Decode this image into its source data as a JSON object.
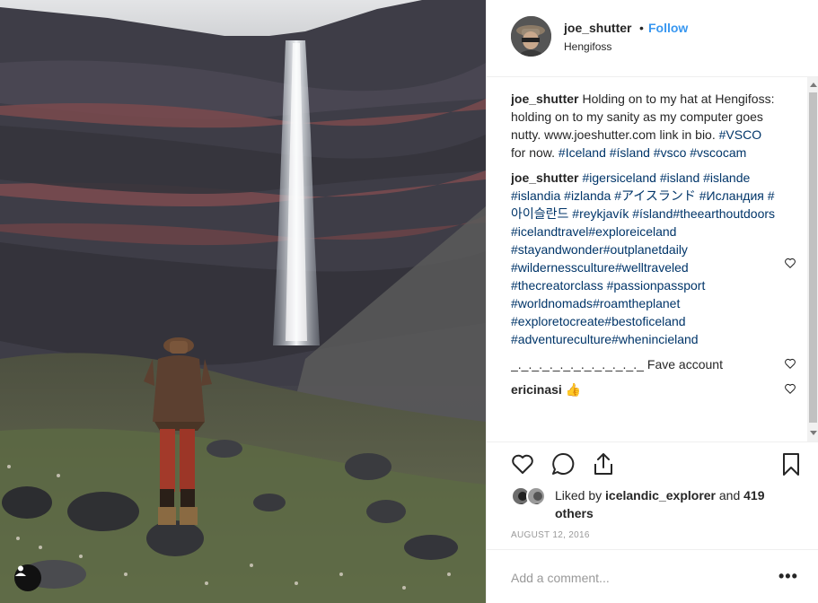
{
  "post": {
    "username": "joe_shutter",
    "separator": "•",
    "follow_label": "Follow",
    "location": "Hengifoss",
    "photo_alt": "Person holding hat in front of Hengifoss waterfall with red-striped canyon walls"
  },
  "comments": [
    {
      "author": "joe_shutter",
      "text": "Holding on to my hat at Hengifoss: holding on to my sanity as my computer goes nutty. www.joeshutter.com link in bio.",
      "tags": [
        "#VSCO",
        " for now. ",
        "#Iceland",
        " ",
        "#ísland",
        " ",
        "#vsco",
        " ",
        "#vscocam"
      ]
    },
    {
      "author": "joe_shutter",
      "tags": [
        "#igersiceland",
        " ",
        "#island",
        " ",
        "#islande",
        " ",
        "#islandia",
        " ",
        "#izlanda",
        " ",
        "#アイスランド",
        " ",
        "#Исландия",
        " ",
        "#아이슬란드",
        "  ",
        "#reykjavík",
        " ",
        "#ísland",
        "",
        "#theearthoutdoors",
        " ",
        "#icelandtravel",
        "",
        "#exploreiceland",
        " ",
        "#stayandwonder",
        "",
        "#outplanetdaily",
        " ",
        "#wildernessculture",
        "",
        "#welltraveled",
        " ",
        "#thecreatorclass",
        " ",
        "#passionpassport",
        " ",
        "#worldnomads",
        "",
        "#roamtheplanet",
        " ",
        "#exploretocreate",
        "",
        "#bestoficeland",
        " ",
        "#adventureculture",
        "",
        "#whenincieland"
      ]
    },
    {
      "author": "_._._._._._._._._._._._._",
      "text": "Fave account"
    },
    {
      "author": "ericinasi",
      "text": "👍"
    }
  ],
  "likes": {
    "prefix": "Liked by",
    "user": "icelandic_explorer",
    "connector": "and",
    "others": "419 others"
  },
  "date": "AUGUST 12, 2016",
  "add_comment_placeholder": "Add a comment...",
  "more_label": "•••",
  "colors": {
    "link": "#003569",
    "follow": "#3897f0",
    "muted": "#999999",
    "border": "#efefef"
  },
  "icons": [
    "like-heart-icon",
    "comment-bubble-icon",
    "share-icon",
    "bookmark-icon",
    "user-tag-icon",
    "comment-like-icon"
  ]
}
